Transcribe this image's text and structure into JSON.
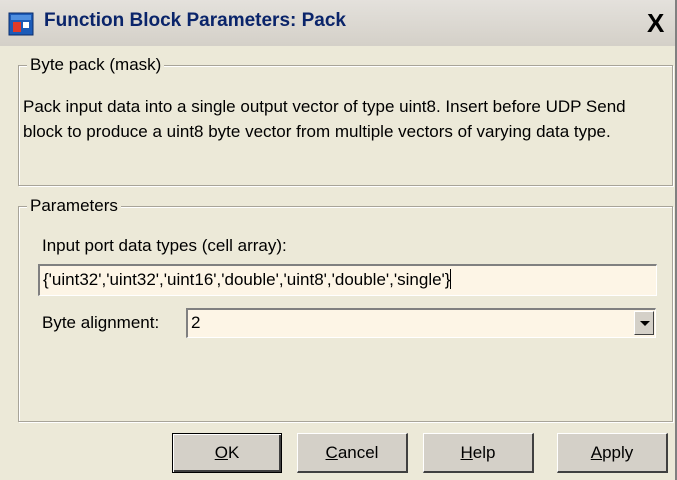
{
  "window": {
    "title": "Function Block Parameters: Pack",
    "close_label": "X",
    "icon": "simulink-block-icon"
  },
  "mask_group": {
    "legend": "Byte pack (mask)",
    "description": "Pack input data into a single output vector of type uint8. Insert before UDP Send block to produce a uint8 byte vector from multiple vectors of varying data type."
  },
  "parameters_group": {
    "legend": "Parameters",
    "input_types_label": "Input port data types (cell array):",
    "input_types_value": "{'uint32','uint32','uint16','double','uint8','double','single'}",
    "byte_alignment_label": "Byte alignment:",
    "byte_alignment_value": "2"
  },
  "buttons": {
    "ok_mnemonic": "O",
    "ok_rest": "K",
    "cancel_mnemonic": "C",
    "cancel_rest": "ancel",
    "help_mnemonic": "H",
    "help_rest": "elp",
    "apply_mnemonic": "A",
    "apply_rest": "pply"
  }
}
